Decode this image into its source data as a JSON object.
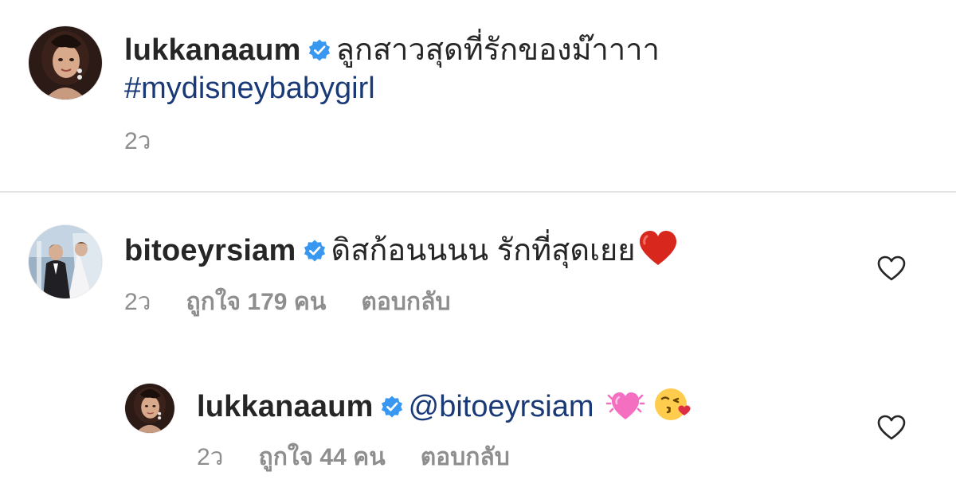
{
  "caption": {
    "username": "lukkanaaum",
    "text": "ลูกสาวสุดที่รักของม๊าาาา",
    "hashtag": "#mydisneybabygirl",
    "time": "2ว"
  },
  "comments": [
    {
      "username": "bitoeyrsiam",
      "text": "ดิสก้อนนนน รักที่สุดเยย",
      "emoji_icons": [
        "red-heart-emoji"
      ],
      "time": "2ว",
      "likes": "ถูกใจ 179 คน",
      "reply_label": "ตอบกลับ"
    },
    {
      "username": "lukkanaaum",
      "mention": "@bitoeyrsiam",
      "emoji_icons": [
        "sparkling-heart-emoji",
        "face-blowing-kiss-emoji"
      ],
      "time": "2ว",
      "likes": "ถูกใจ 44 คน",
      "reply_label": "ตอบกลับ"
    }
  ],
  "colors": {
    "text": "#262626",
    "muted": "#8e8e8e",
    "link": "#1a3a77",
    "verified": "#3897f0",
    "divider": "#e3e3e3"
  },
  "icons": {
    "verified": "verified-badge-icon",
    "like": "heart-outline-icon"
  }
}
